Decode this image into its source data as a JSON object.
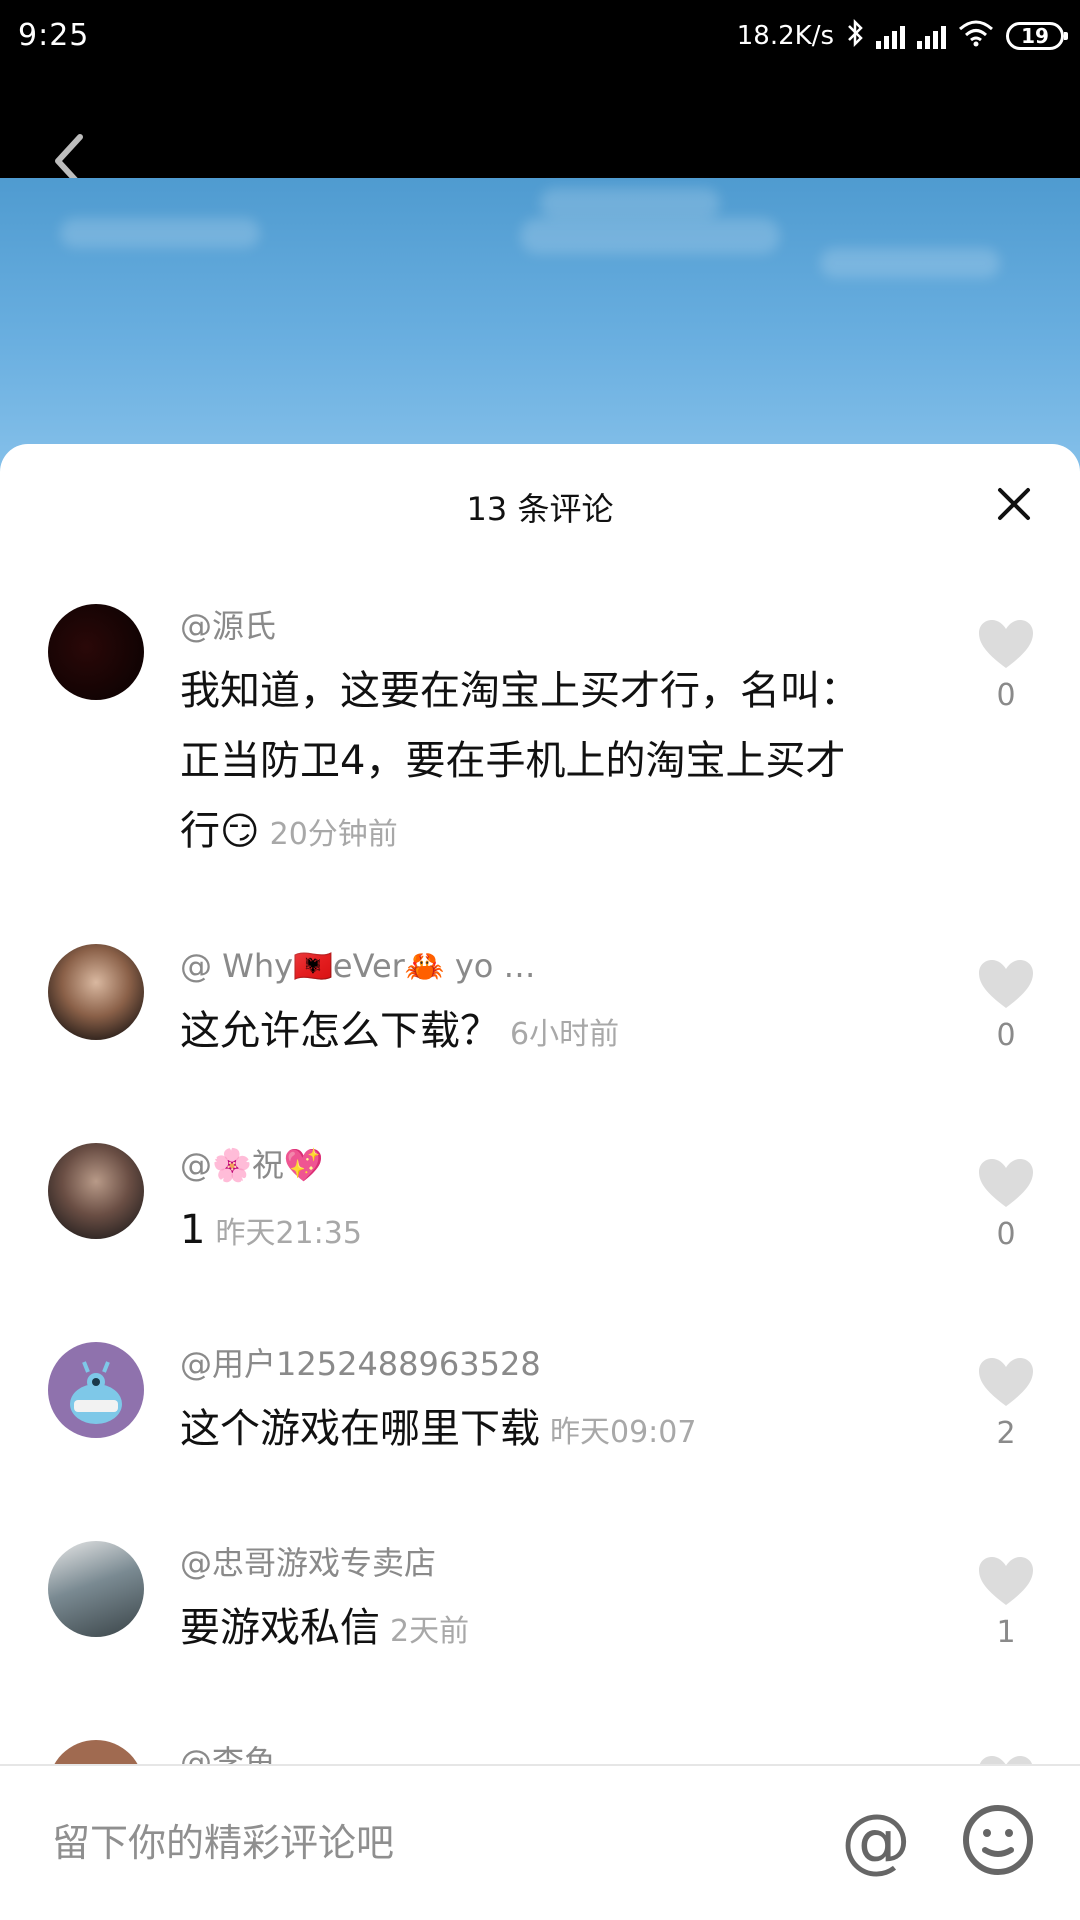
{
  "status_bar": {
    "time": "9:25",
    "network_speed": "18.2K/s",
    "battery": "19"
  },
  "sheet": {
    "title": "13 条评论",
    "close_icon": "close-icon"
  },
  "comments": [
    {
      "username": "@源氏",
      "text": "我知道，这要在淘宝上买才行，名叫：正当防卫4，要在手机上的淘宝上买才行",
      "emoji": "😏",
      "timestamp": "20分钟前",
      "likes": "0",
      "avatar_color": "#1a0505"
    },
    {
      "username": "@ Why🇦🇱eVer🦀 yo …",
      "text": "这允许怎么下载？",
      "emoji": "",
      "timestamp": "6小时前",
      "likes": "0",
      "avatar_color": "#6b4a3a"
    },
    {
      "username": "@🌸祝💖",
      "text": "1",
      "emoji": "",
      "timestamp": "昨天21:35",
      "likes": "0",
      "avatar_color": "#4b3a36"
    },
    {
      "username": "@用户1252488963528",
      "text": "这个游戏在哪里下载",
      "emoji": "",
      "timestamp": "昨天09:07",
      "likes": "2",
      "avatar_color": "#8a6aa8"
    },
    {
      "username": "@忠哥游戏专卖店",
      "text": "要游戏私信",
      "emoji": "",
      "timestamp": "2天前",
      "likes": "1",
      "avatar_color": "#5d6a70"
    },
    {
      "username": "@李鱼",
      "text": "",
      "emoji": "",
      "timestamp": "",
      "likes": "",
      "avatar_color": "#a06a50"
    }
  ],
  "input_bar": {
    "placeholder": "留下你的精彩评论吧",
    "mention_label": "@"
  },
  "colors": {
    "like_icon": "#dcdcdc",
    "username": "#8a8a8a",
    "timestamp": "#a8a8a8"
  }
}
